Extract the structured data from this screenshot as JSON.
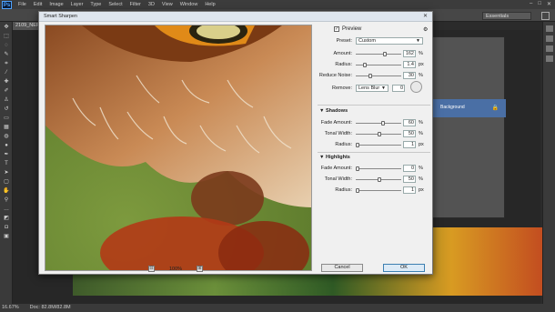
{
  "menubar": {
    "logo": "Ps",
    "items": [
      "File",
      "Edit",
      "Image",
      "Layer",
      "Type",
      "Select",
      "Filter",
      "3D",
      "View",
      "Window",
      "Help"
    ],
    "window_controls": [
      "–",
      "□",
      "✕"
    ]
  },
  "optbar": {
    "workspace": "Essentials"
  },
  "doc_tab": "2109_NEF @",
  "panel": {
    "layer_name": "Background"
  },
  "statusbar": {
    "zoom": "16.67%",
    "doc": "Doc: 82.8M/82.8M"
  },
  "dialog": {
    "title": "Smart Sharpen",
    "close": "✕",
    "preview_label": "Preview",
    "preview_checked": true,
    "preset_label": "Preset:",
    "preset_value": "Custom",
    "amount_label": "Amount:",
    "amount_value": "162",
    "amount_unit": "%",
    "radius_label": "Radius:",
    "radius_value": "1.4",
    "radius_unit": "px",
    "noise_label": "Reduce Noise:",
    "noise_value": "30",
    "noise_unit": "%",
    "remove_label": "Remove:",
    "remove_value": "Lens Blur",
    "angle_value": "0",
    "shadows_title": "Shadows",
    "sh_fade_label": "Fade Amount:",
    "sh_fade_value": "60",
    "sh_tonal_label": "Tonal Width:",
    "sh_tonal_value": "50",
    "sh_radius_label": "Radius:",
    "sh_radius_value": "1",
    "highlights_title": "Highlights",
    "hl_fade_label": "Fade Amount:",
    "hl_fade_value": "0",
    "hl_tonal_label": "Tonal Width:",
    "hl_tonal_value": "50",
    "hl_radius_label": "Radius:",
    "hl_radius_value": "1",
    "pct": "%",
    "px": "px",
    "zoom_value": "100%",
    "zoom_out": "⊟",
    "zoom_in": "⊞",
    "cancel_label": "Cancel",
    "ok_label": "OK"
  }
}
